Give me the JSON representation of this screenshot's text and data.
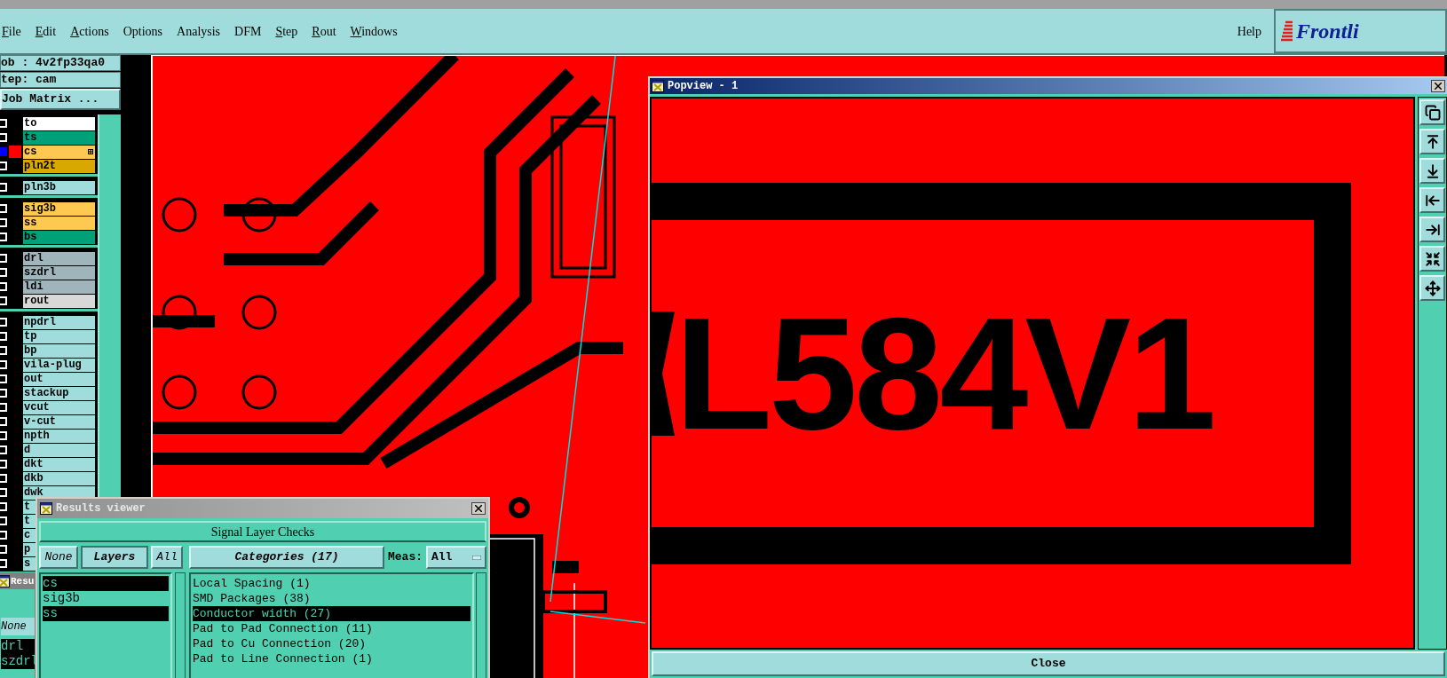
{
  "menu_bar": {
    "items": [
      {
        "label": "File",
        "mnemonic": true
      },
      {
        "label": "Edit",
        "mnemonic": true
      },
      {
        "label": "Actions",
        "mnemonic": true
      },
      {
        "label": "Options",
        "mnemonic": false
      },
      {
        "label": "Analysis",
        "mnemonic": false
      },
      {
        "label": "DFM",
        "mnemonic": false
      },
      {
        "label": "Step",
        "mnemonic": true
      },
      {
        "label": "Rout",
        "mnemonic": true
      },
      {
        "label": "Windows",
        "mnemonic": true
      }
    ],
    "help": "Help",
    "logo": "Frontli"
  },
  "job_panel": {
    "job": "ob : 4v2fp33qa0",
    "step": "tep: cam",
    "matrix_button": "Job Matrix ..."
  },
  "layer_groups": [
    {
      "layers": [
        {
          "name": "to",
          "color": "#ffffff",
          "work": false,
          "affected": false,
          "expandable": false
        },
        {
          "name": "ts",
          "color": "#00a078",
          "work": false,
          "affected": false,
          "expandable": false
        },
        {
          "name": "cs",
          "color": "#ffc850",
          "work": true,
          "affected": true,
          "expandable": true
        },
        {
          "name": "pln2t",
          "color": "#d8a800",
          "work": false,
          "affected": false,
          "expandable": false
        }
      ]
    },
    {
      "layers": [
        {
          "name": "pln3b",
          "color": "#a0dcdc",
          "work": false,
          "affected": false,
          "expandable": false
        }
      ]
    },
    {
      "layers": [
        {
          "name": "sig3b",
          "color": "#ffc850",
          "work": false,
          "affected": false,
          "expandable": false
        },
        {
          "name": "ss",
          "color": "#ffc850",
          "work": false,
          "affected": false,
          "expandable": false
        },
        {
          "name": "bs",
          "color": "#00a078",
          "work": false,
          "affected": false,
          "expandable": false
        }
      ]
    },
    {
      "layers": [
        {
          "name": "drl",
          "color": "#a0b4bc",
          "work": false,
          "affected": false,
          "expandable": false
        },
        {
          "name": "szdrl",
          "color": "#a0b4bc",
          "work": false,
          "affected": false,
          "expandable": false
        },
        {
          "name": "ldi",
          "color": "#a0b4bc",
          "work": false,
          "affected": false,
          "expandable": false
        },
        {
          "name": "rout",
          "color": "#d8d8d8",
          "work": false,
          "affected": false,
          "expandable": false
        }
      ]
    },
    {
      "layers": [
        {
          "name": "npdrl",
          "color": "#a0dcdc",
          "work": false,
          "affected": false,
          "expandable": false
        },
        {
          "name": "tp",
          "color": "#a0dcdc",
          "work": false,
          "affected": false,
          "expandable": false
        },
        {
          "name": "bp",
          "color": "#a0dcdc",
          "work": false,
          "affected": false,
          "expandable": false
        },
        {
          "name": "vila-plug",
          "color": "#a0dcdc",
          "work": false,
          "affected": false,
          "expandable": false
        },
        {
          "name": "out",
          "color": "#a0dcdc",
          "work": false,
          "affected": false,
          "expandable": false
        },
        {
          "name": "stackup",
          "color": "#a0dcdc",
          "work": false,
          "affected": false,
          "expandable": false
        },
        {
          "name": "vcut",
          "color": "#a0dcdc",
          "work": false,
          "affected": false,
          "expandable": false
        },
        {
          "name": "v-cut",
          "color": "#a0dcdc",
          "work": false,
          "affected": false,
          "expandable": false
        },
        {
          "name": "npth",
          "color": "#a0dcdc",
          "work": false,
          "affected": false,
          "expandable": false
        },
        {
          "name": "d",
          "color": "#a0dcdc",
          "work": false,
          "affected": false,
          "expandable": false
        },
        {
          "name": "dkt",
          "color": "#a0dcdc",
          "work": false,
          "affected": false,
          "expandable": false
        },
        {
          "name": "dkb",
          "color": "#a0dcdc",
          "work": false,
          "affected": false,
          "expandable": false
        },
        {
          "name": "dwk",
          "color": "#a0dcdc",
          "work": false,
          "affected": false,
          "expandable": false
        },
        {
          "name": "t",
          "color": "#a0dcdc",
          "work": false,
          "affected": false,
          "expandable": false
        },
        {
          "name": "t",
          "color": "#a0dcdc",
          "work": false,
          "affected": false,
          "expandable": false
        },
        {
          "name": "c",
          "color": "#a0dcdc",
          "work": false,
          "affected": false,
          "expandable": false
        },
        {
          "name": "p",
          "color": "#a0dcdc",
          "work": false,
          "affected": false,
          "expandable": false
        },
        {
          "name": "s",
          "color": "#a0dcdc",
          "work": false,
          "affected": false,
          "expandable": false
        }
      ]
    }
  ],
  "results_viewer_behind": {
    "title": "Resu",
    "none_button": "None",
    "layers": [
      {
        "name": "drl",
        "selected": true
      },
      {
        "name": "szdrl",
        "selected": true
      }
    ]
  },
  "results_viewer": {
    "title": "Results viewer",
    "header": "Signal Layer Checks",
    "none_button": "None",
    "layers_button": "Layers",
    "all_button": "All",
    "categories_button": "Categories (17)",
    "meas_label": "Meas:",
    "meas_value": "All",
    "layers": [
      {
        "name": "cs",
        "selected": true
      },
      {
        "name": "sig3b",
        "selected": false
      },
      {
        "name": "ss",
        "selected": true
      }
    ],
    "categories": [
      {
        "label": "Local Spacing (1)",
        "selected": false
      },
      {
        "label": "SMD Packages (38)",
        "selected": false
      },
      {
        "label": "Conductor width (27)",
        "selected": true
      },
      {
        "label": "Pad to Pad Connection (11)",
        "selected": false
      },
      {
        "label": "Pad to Cu Connection (20)",
        "selected": false
      },
      {
        "label": "Pad to Line Connection (1)",
        "selected": false
      }
    ]
  },
  "popview": {
    "title": "Popview - 1",
    "board_text": "L584V1",
    "close_button": "Close"
  }
}
